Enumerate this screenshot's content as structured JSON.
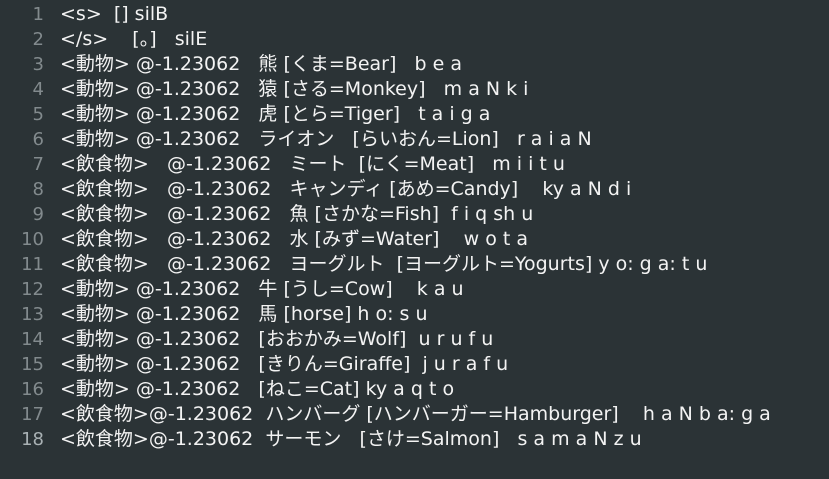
{
  "editor": {
    "lines": [
      {
        "no": "1",
        "text": "<s>  [] silB"
      },
      {
        "no": "2",
        "text": "</s>    [。]   silE"
      },
      {
        "no": "3",
        "text": "<動物> @-1.23062   熊 [くま=Bear]   b e a"
      },
      {
        "no": "4",
        "text": "<動物> @-1.23062   猿 [さる=Monkey]   m a N k i"
      },
      {
        "no": "5",
        "text": "<動物> @-1.23062   虎 [とら=Tiger]   t a i g a"
      },
      {
        "no": "6",
        "text": "<動物> @-1.23062   ライオン   [らいおん=Lion]   r a i a N"
      },
      {
        "no": "7",
        "text": "<飲食物>   @-1.23062   ミート  [にく=Meat]   m i i t u"
      },
      {
        "no": "8",
        "text": "<飲食物>   @-1.23062   キャンディ [あめ=Candy]    ky a N d i"
      },
      {
        "no": "9",
        "text": "<飲食物>   @-1.23062   魚 [さかな=Fish]  f i q sh u"
      },
      {
        "no": "10",
        "text": "<飲食物>   @-1.23062   水 [みず=Water]    w o t a"
      },
      {
        "no": "11",
        "text": "<飲食物>   @-1.23062   ヨーグルト  [ヨーグルト=Yogurts] y o: g a: t u"
      },
      {
        "no": "12",
        "text": "<動物> @-1.23062   牛 [うし=Cow]    k a u"
      },
      {
        "no": "13",
        "text": "<動物> @-1.23062   馬 [horse] h o: s u"
      },
      {
        "no": "14",
        "text": "<動物> @-1.23062   [おおかみ=Wolf]  u r u f u"
      },
      {
        "no": "15",
        "text": "<動物> @-1.23062   [きりん=Giraffe]  j u r a f u"
      },
      {
        "no": "16",
        "text": "<動物> @-1.23062   [ねこ=Cat] ky a q t o"
      },
      {
        "no": "17",
        "text": "<飲食物>@-1.23062  ハンバーグ [ハンバーガー=Hamburger]    h a N b a: g a"
      },
      {
        "no": "18",
        "text": "<飲食物>@-1.23062  サーモン   [さけ=Salmon]   s a m a N z u"
      }
    ],
    "current_line": 18,
    "colors": {
      "background": "#2b3336",
      "text": "#f3f3f3",
      "line_number": "#828a8d",
      "current_line_bg": "#30393c"
    }
  }
}
